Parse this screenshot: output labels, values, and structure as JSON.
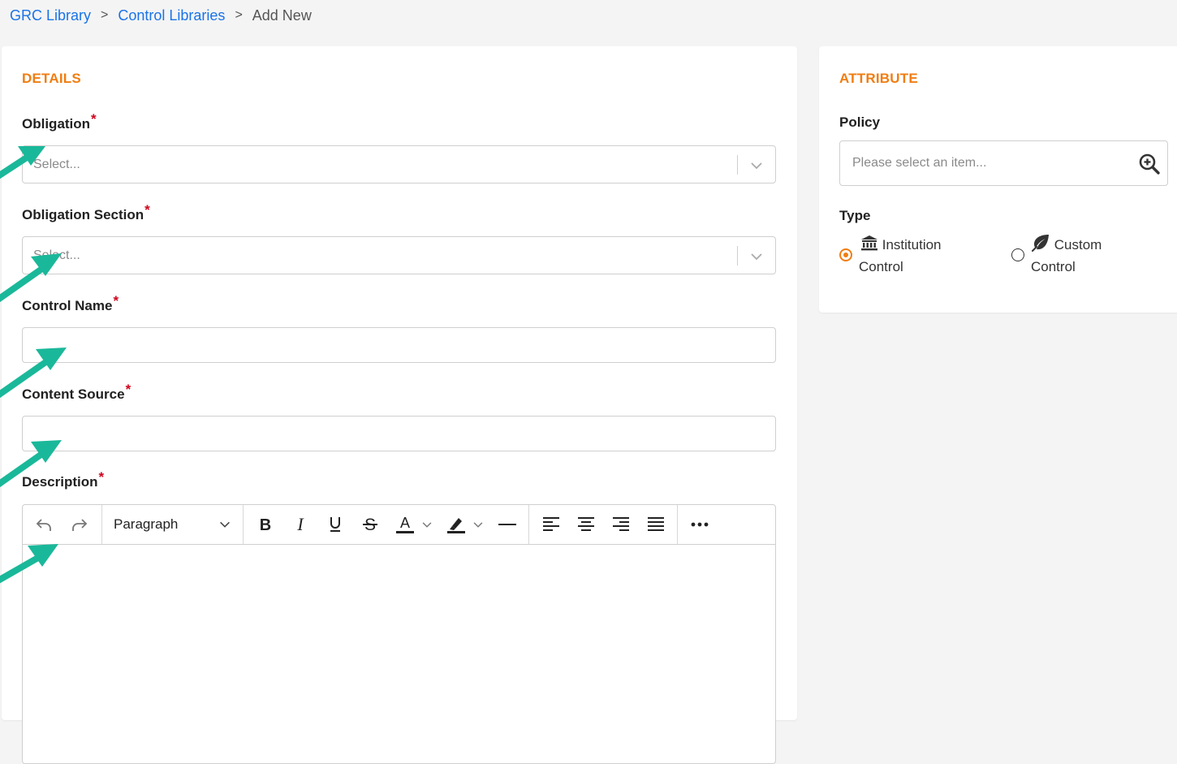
{
  "breadcrumb": {
    "item1": "GRC Library",
    "item2": "Control Libraries",
    "current": "Add New",
    "sep": ">"
  },
  "details": {
    "title": "DETAILS",
    "obligation": {
      "label": "Obligation",
      "placeholder": "Select..."
    },
    "obligation_section": {
      "label": "Obligation Section",
      "placeholder": "Select..."
    },
    "control_name": {
      "label": "Control Name",
      "value": ""
    },
    "content_source": {
      "label": "Content Source",
      "value": ""
    },
    "description": {
      "label": "Description",
      "paragraph": "Paragraph",
      "icons": [
        "undo-icon",
        "redo-icon",
        "chevron-down-icon",
        "bold-icon",
        "italic-icon",
        "underline-icon",
        "strikethrough-icon",
        "font-color-icon",
        "highlight-icon",
        "horizontal-line-icon",
        "align-left-icon",
        "align-center-icon",
        "align-right-icon",
        "align-justify-icon",
        "more-icon"
      ]
    },
    "required_mark": "*"
  },
  "attribute": {
    "title": "ATTRIBUTE",
    "policy": {
      "label": "Policy",
      "placeholder": "Please select an item..."
    },
    "type": {
      "label": "Type",
      "options": [
        {
          "line1": "Institution",
          "line2": "Control",
          "icon": "institution-icon",
          "selected": true
        },
        {
          "line1": "Custom",
          "line2": "Control",
          "icon": "leaf-icon",
          "selected": false
        }
      ]
    }
  },
  "colors": {
    "accent": "#f07d12",
    "link": "#1a73e8",
    "required": "#d0021b",
    "annotation_arrow": "#1ab89a"
  }
}
